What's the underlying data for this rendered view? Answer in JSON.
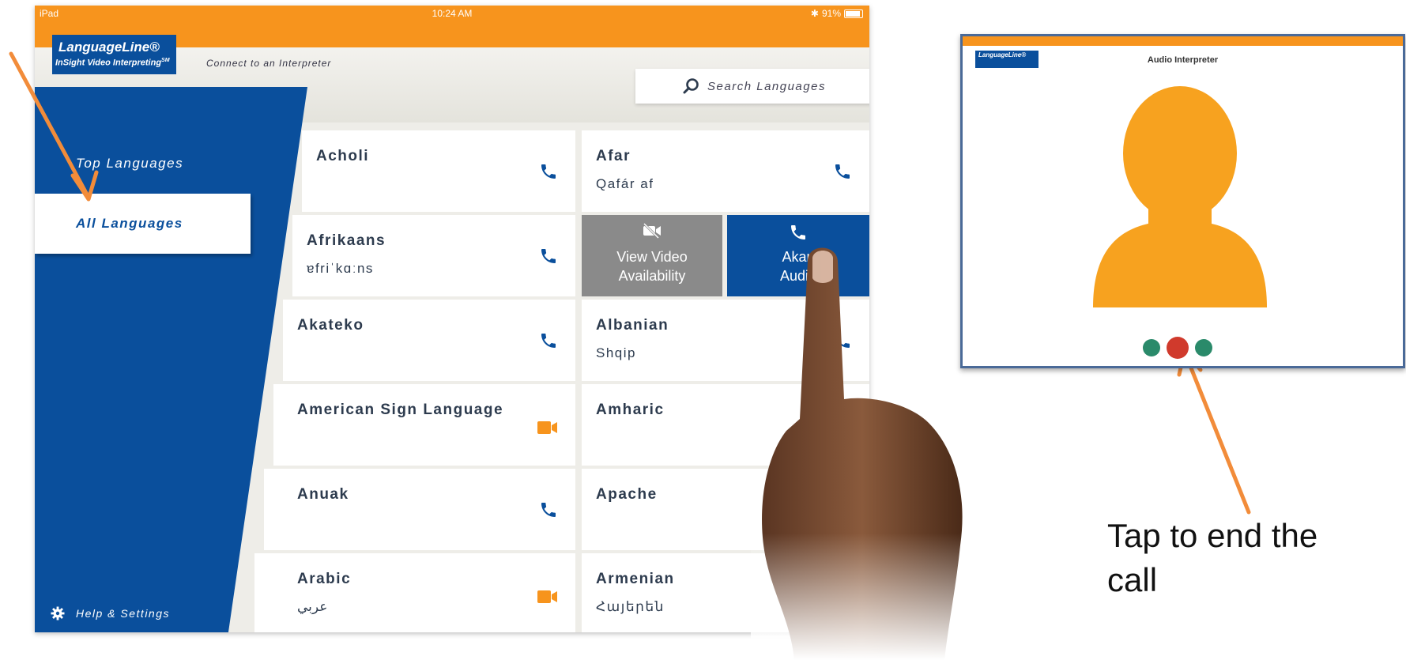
{
  "ipad": {
    "status": {
      "device": "iPad",
      "time": "10:24 AM",
      "battery": "91%"
    },
    "logo": {
      "line1": "LanguageLine®",
      "line2": "InSight Video Interpreting",
      "sm": "SM"
    },
    "tagline": "Connect to an Interpreter",
    "search": {
      "placeholder": "Search Languages"
    },
    "sidebar": {
      "top_languages": "Top Languages",
      "all_languages": "All Languages",
      "help_settings": "Help & Settings"
    },
    "languages": [
      {
        "name": "Acholi",
        "native": "",
        "icon": "phone-icon"
      },
      {
        "name": "Afar",
        "native": "Qafár af",
        "icon": "phone-icon"
      },
      {
        "name": "Afrikaans",
        "native": "ɐfriˈkɑːns",
        "icon": "phone-icon"
      },
      {
        "name": "Akateko",
        "native": "",
        "icon": "phone-icon"
      },
      {
        "name": "Albanian",
        "native": "Shqip",
        "icon": "phone-icon"
      },
      {
        "name": "American Sign Language",
        "native": "",
        "icon": "video-icon"
      },
      {
        "name": "Amharic",
        "native": "",
        "icon": "phone-icon"
      },
      {
        "name": "Anuak",
        "native": "",
        "icon": "phone-icon"
      },
      {
        "name": "Apache",
        "native": "",
        "icon": "phone-icon"
      },
      {
        "name": "Arabic",
        "native": "عربي",
        "icon": "video-icon"
      },
      {
        "name": "Armenian",
        "native": "Հայերեն",
        "icon": "phone-icon"
      }
    ],
    "swipe_actions": {
      "video_label": "View Video Availability",
      "audio_label": "Akan Audio"
    }
  },
  "call_screen": {
    "title": "Audio Interpreter"
  },
  "caption": "Tap to end the call",
  "colors": {
    "accent": "#f7941d",
    "brand": "#0a4f9c",
    "end_call": "#d03a2c"
  }
}
